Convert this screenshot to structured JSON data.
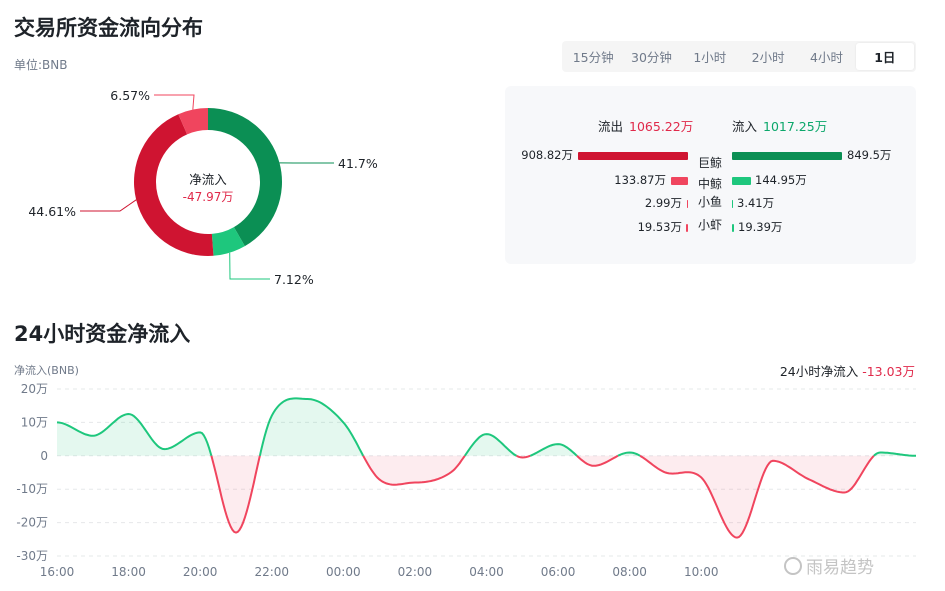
{
  "title": "交易所资金流向分布",
  "unit": "单位:BNB",
  "timeframes": [
    "15分钟",
    "30分钟",
    "1小时",
    "2小时",
    "4小时",
    "1日"
  ],
  "active_timeframe": "1日",
  "donut": {
    "center_label": "净流入",
    "center_value": "-47.97万",
    "labels": [
      "41.7%",
      "7.12%",
      "44.61%",
      "6.57%"
    ]
  },
  "flow": {
    "outflow_label": "流出",
    "outflow_total": "1065.22万",
    "inflow_label": "流入",
    "inflow_total": "1017.25万",
    "rows": [
      {
        "category": "巨鲸",
        "out": "908.82万",
        "in": "849.5万"
      },
      {
        "category": "中鲸",
        "out": "133.87万",
        "in": "144.95万"
      },
      {
        "category": "小鱼",
        "out": "2.99万",
        "in": "3.41万"
      },
      {
        "category": "小虾",
        "out": "19.53万",
        "in": "19.39万"
      }
    ]
  },
  "net_title": "24小时资金净流入",
  "net_ylabel": "净流入(BNB)",
  "net_summary_label": "24小时净流入",
  "net_summary_value": "-13.03万",
  "watermark": "雨易趋势",
  "colors": {
    "inflow_large": "#0b8f54",
    "inflow_medium": "#1ec77d",
    "outflow_large": "#cf1431",
    "outflow_medium": "#f0455e",
    "positive_line": "#1ec77d",
    "negative_line": "#f0455e"
  },
  "chart_data": [
    {
      "type": "pie",
      "style": "donut",
      "categories": [
        "巨鲸流入",
        "中鲸流入",
        "巨鲸流出",
        "中鲸流出"
      ],
      "values": [
        41.7,
        7.12,
        44.61,
        6.57
      ]
    },
    {
      "type": "bar",
      "orientation": "horizontal",
      "categories": [
        "巨鲸",
        "中鲸",
        "小鱼",
        "小虾"
      ],
      "series": [
        {
          "name": "流出",
          "values": [
            908.82,
            133.87,
            2.99,
            19.53
          ]
        },
        {
          "name": "流入",
          "values": [
            849.5,
            144.95,
            3.41,
            19.39
          ]
        }
      ]
    },
    {
      "type": "area",
      "ylabel": "净流入(BNB)",
      "ylim": [
        -30,
        20
      ],
      "yticks": [
        20,
        10,
        0,
        -10,
        -20,
        -30
      ],
      "ytick_labels": [
        "20万",
        "10万",
        "0",
        "-10万",
        "-20万",
        "-30万"
      ],
      "xlim": [
        0,
        24
      ],
      "xticks": [
        0,
        2,
        4,
        6,
        8,
        10,
        12,
        14,
        16,
        18
      ],
      "xtick_labels": [
        "16:00",
        "18:00",
        "20:00",
        "22:00",
        "00:00",
        "02:00",
        "04:00",
        "06:00",
        "08:00",
        "10:00"
      ],
      "grid": true,
      "x": [
        0,
        1,
        2,
        3,
        4,
        5,
        6,
        7,
        8,
        9,
        10,
        11,
        12,
        13,
        14,
        15,
        16,
        17,
        18,
        19,
        20,
        21,
        22,
        23,
        24
      ],
      "values": [
        10,
        6,
        12.5,
        2,
        7,
        -23,
        12,
        17,
        10,
        -7,
        -8,
        -5,
        6.5,
        -0.5,
        3.5,
        -3,
        1,
        -5,
        -6.5,
        -24.5,
        -1.5,
        -7,
        -11,
        1,
        0
      ]
    }
  ]
}
